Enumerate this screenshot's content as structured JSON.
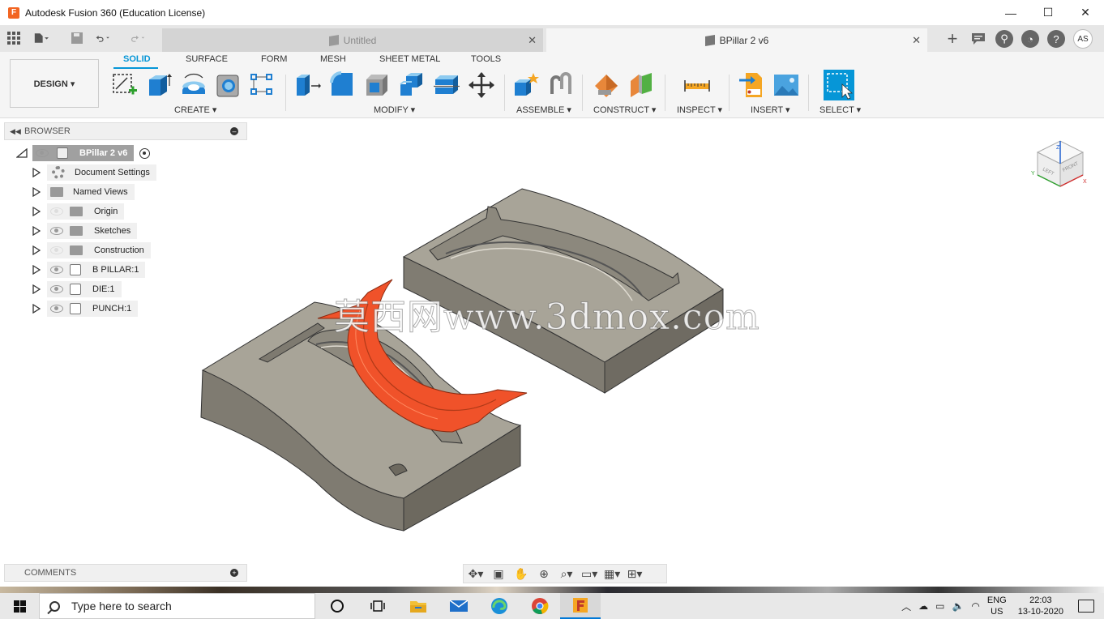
{
  "window": {
    "title": "Autodesk Fusion 360 (Education License)",
    "logo": "F",
    "minimize": "—",
    "maximize": "☐",
    "close": "✕"
  },
  "tabs": [
    {
      "label": "Untitled",
      "active": false
    },
    {
      "label": "BPillar 2 v6",
      "active": true
    }
  ],
  "user": {
    "initials": "AS"
  },
  "workspace": {
    "label": "DESIGN ▾"
  },
  "toolbar_tabs": [
    "SOLID",
    "SURFACE",
    "FORM",
    "MESH",
    "SHEET METAL",
    "TOOLS"
  ],
  "tool_groups": [
    "CREATE ▾",
    "MODIFY ▾",
    "ASSEMBLE ▾",
    "CONSTRUCT ▾",
    "INSPECT ▾",
    "INSERT ▾",
    "SELECT ▾"
  ],
  "browser": {
    "title": "BROWSER",
    "root": "BPillar 2 v6",
    "items": [
      {
        "label": "Document Settings",
        "icon": "gear-icon"
      },
      {
        "label": "Named Views",
        "icon": "folder-icon"
      },
      {
        "label": "Origin",
        "icon": "folder-icon"
      },
      {
        "label": "Sketches",
        "icon": "folder-icon"
      },
      {
        "label": "Construction",
        "icon": "folder-icon"
      },
      {
        "label": "B PILLAR:1",
        "icon": "component-icon"
      },
      {
        "label": "DIE:1",
        "icon": "component-icon"
      },
      {
        "label": "PUNCH:1",
        "icon": "component-icon"
      }
    ]
  },
  "comments": {
    "title": "COMMENTS"
  },
  "watermark": "莫西网www.3dmox.com",
  "viewcube": {
    "left": "LEFT",
    "front": "FRONT",
    "z": "Z",
    "x": "X",
    "y": "Y"
  },
  "taskbar": {
    "search_placeholder": "Type here to search",
    "lang_top": "ENG",
    "lang_bottom": "US",
    "time": "22:03",
    "date": "13-10-2020"
  },
  "colors": {
    "accent": "#0696d7",
    "part_orange": "#f0522a",
    "die_gray": "#8b877c"
  }
}
